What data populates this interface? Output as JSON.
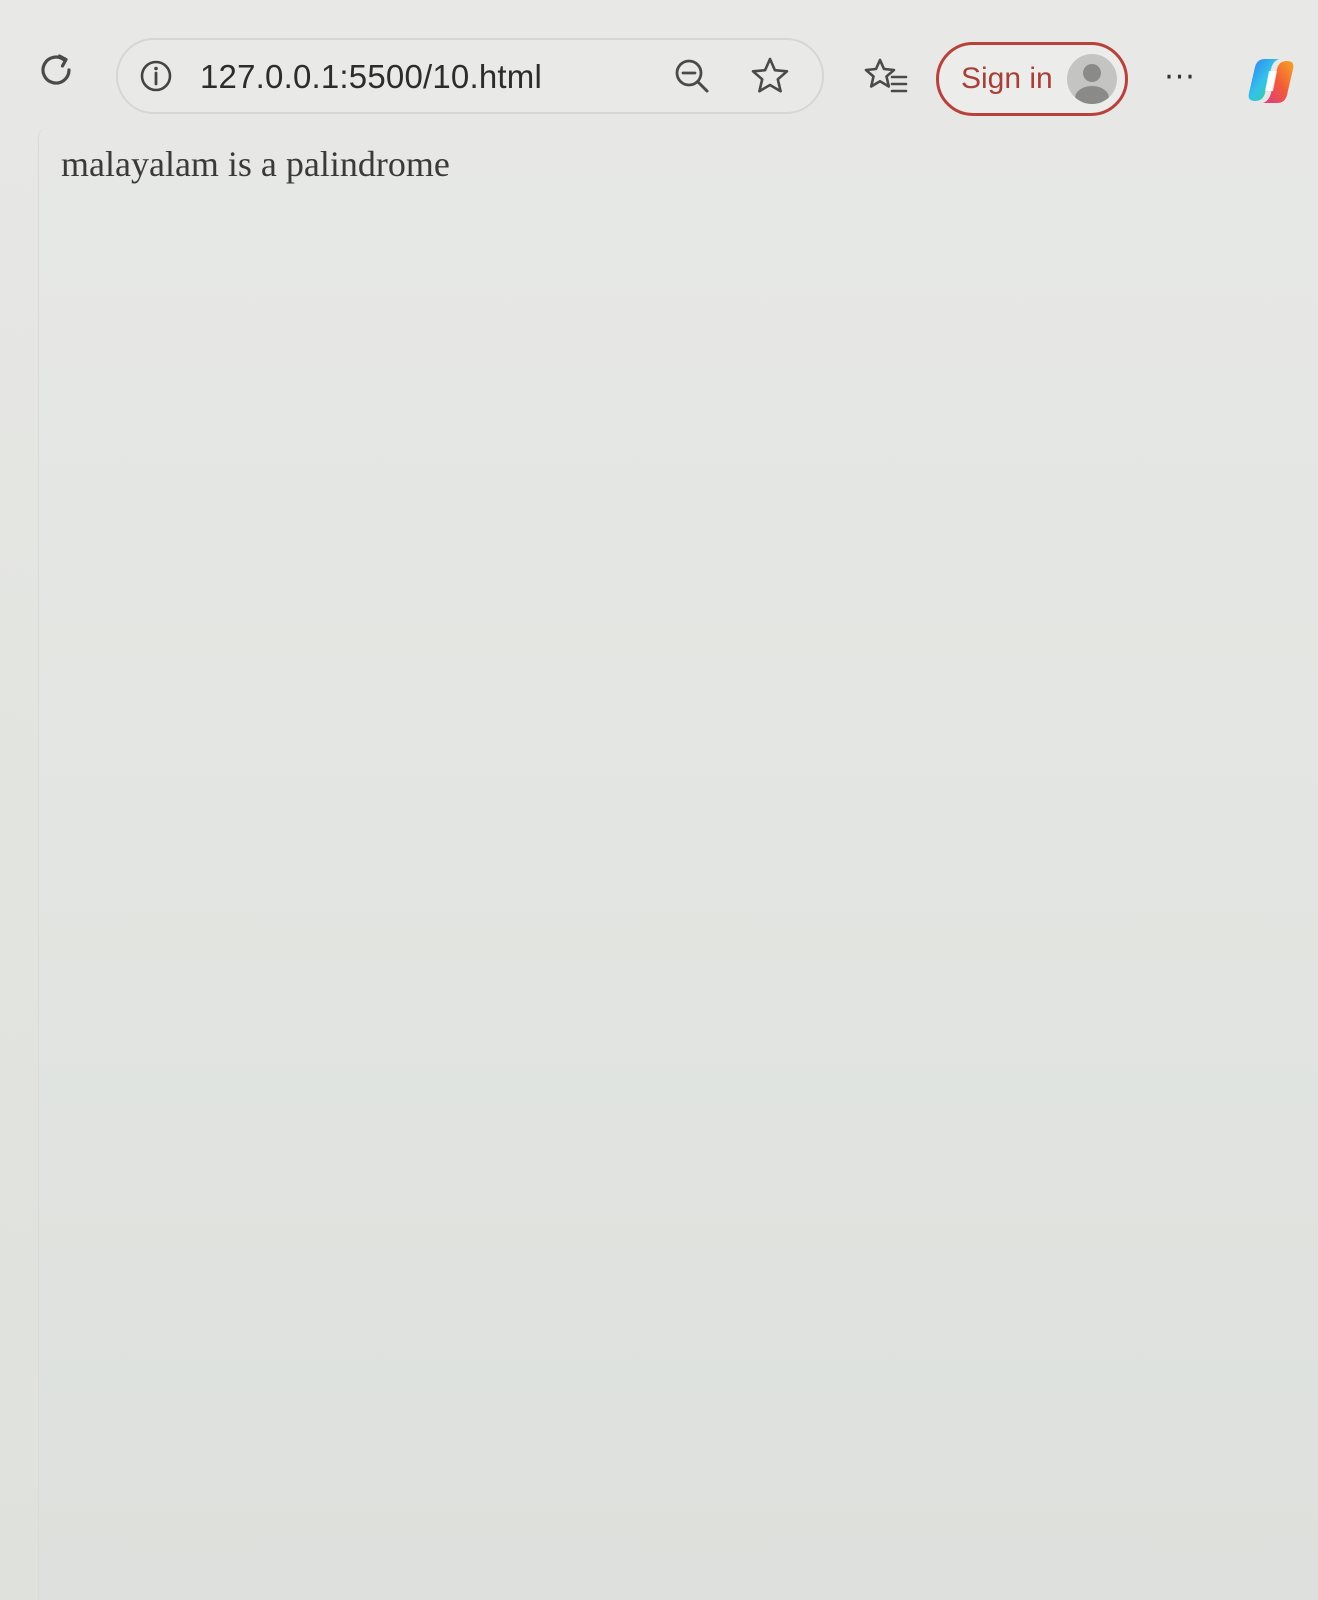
{
  "toolbar": {
    "url": "127.0.0.1:5500/10.html",
    "signin_label": "Sign in",
    "more_label": "···"
  },
  "icons": {
    "reload": "reload-icon",
    "info": "info-icon",
    "zoom": "zoom-out-icon",
    "star": "star-icon",
    "favorites": "favorites-icon",
    "profile": "profile-avatar-icon",
    "copilot": "copilot-icon"
  },
  "colors": {
    "signin_accent": "#b8413c",
    "page_background": "#e4e6e2",
    "text": "#3a3a3a"
  },
  "page": {
    "body_text": "malayalam is a palindrome"
  }
}
